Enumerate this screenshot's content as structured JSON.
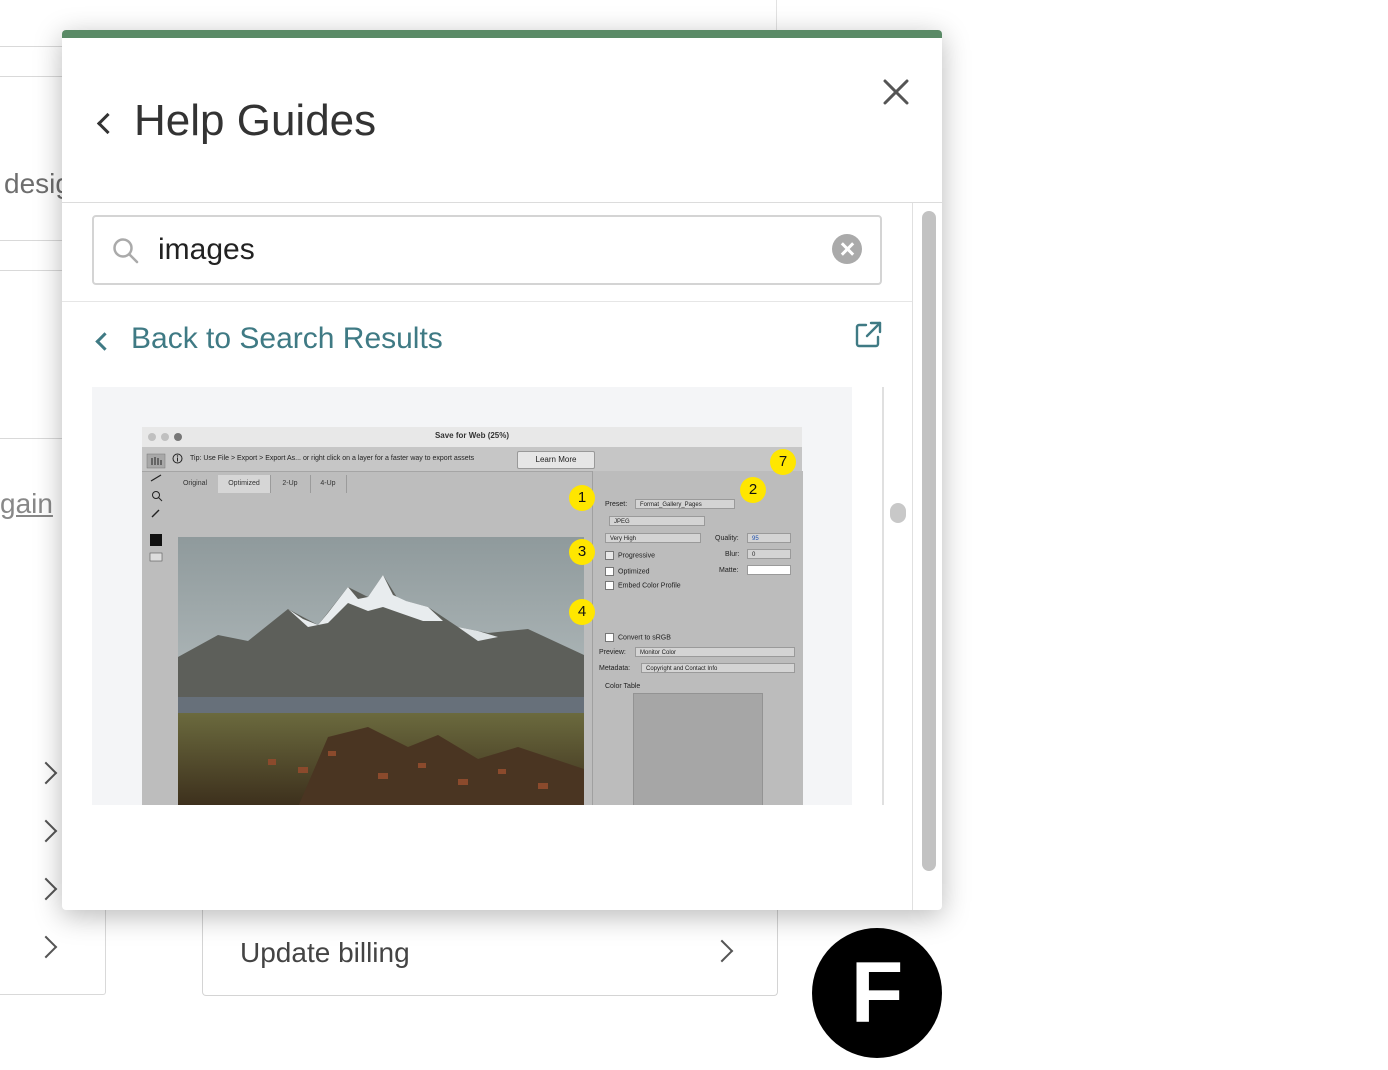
{
  "background": {
    "partial_text_design": "desig",
    "partial_link_again": "gain",
    "update_billing_label": "Update billing",
    "fab_letter": "F"
  },
  "panel": {
    "title": "Help Guides",
    "search": {
      "value": "images"
    },
    "back_link_label": "Back to Search Results",
    "article_image": {
      "window_title": "Save for Web (25%)",
      "tip_text": "Tip: Use File > Export > Export As...  or right click on a layer for a faster way to export assets",
      "learn_more": "Learn More",
      "tabs": [
        "Original",
        "Optimized",
        "2-Up",
        "4-Up"
      ],
      "settings": {
        "preset_label": "Preset:",
        "preset_value": "Format_Gallery_Pages",
        "format_value": "JPEG",
        "quality_preset": "Very High",
        "quality_label": "Quality:",
        "quality_value": "95",
        "progressive_label": "Progressive",
        "blur_label": "Blur:",
        "blur_value": "0",
        "optimized_label": "Optimized",
        "matte_label": "Matte:",
        "embed_label": "Embed Color Profile",
        "convert_label": "Convert to sRGB",
        "preview_label": "Preview:",
        "preview_value": "Monitor Color",
        "metadata_label": "Metadata:",
        "metadata_value": "Copyright and Contact Info",
        "color_table_label": "Color Table"
      },
      "badges": [
        "1",
        "2",
        "3",
        "4",
        "7"
      ]
    }
  },
  "colors": {
    "accent_bar": "#5a8a66",
    "link": "#3f7a84",
    "badge": "#ffe600"
  }
}
